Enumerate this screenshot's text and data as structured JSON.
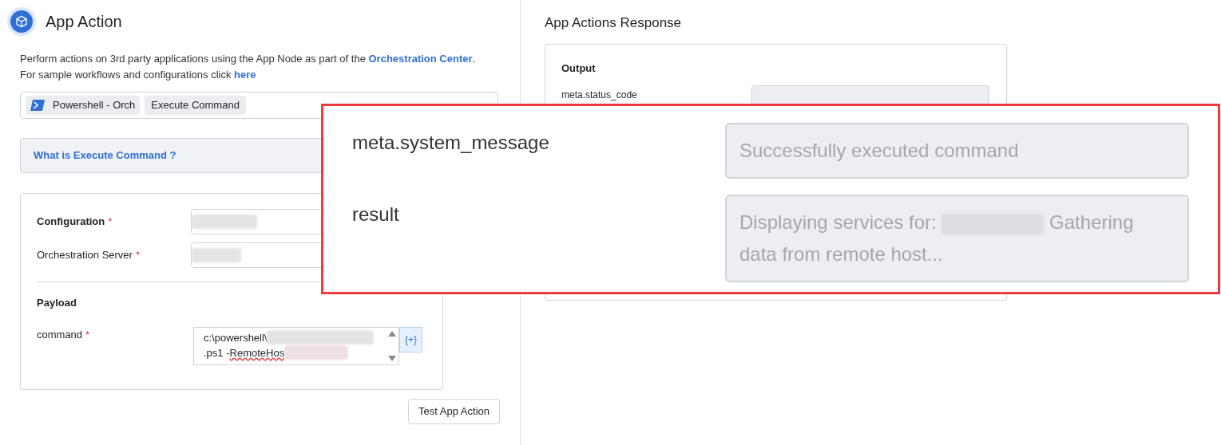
{
  "header": {
    "title": "App Action"
  },
  "description": {
    "line1": "Perform actions on 3rd party applications using the App Node as part of the",
    "link1": "Orchestration Center",
    "line1_end": ".",
    "line2": "For sample workflows and configurations click",
    "link2": "here"
  },
  "selection": {
    "app": "Powershell - Orch",
    "action": "Execute Command"
  },
  "help": {
    "label": "What is Execute Command ?"
  },
  "form": {
    "fields": [
      {
        "label": "Configuration",
        "required_mark": "*",
        "bold": true
      },
      {
        "label": "Orchestration Server",
        "required_mark": "*",
        "bold": false
      }
    ],
    "payload_title": "Payload",
    "command": {
      "label": "command",
      "required_mark": "*",
      "line1": "c:\\powershell\\",
      "line2_a": ".ps1 -",
      "line2_b": "RemoteHos"
    },
    "insert_button": "{+}"
  },
  "test_button": "Test App Action",
  "response": {
    "title": "App Actions Response",
    "output_title": "Output",
    "status_label": "meta.status_code"
  },
  "callout": {
    "rows": [
      {
        "label": "meta.system_message",
        "value": "Successfully executed command"
      },
      {
        "label": "result",
        "value_a": "Displaying services for:",
        "value_b": "Gathering data from remote host..."
      }
    ]
  }
}
